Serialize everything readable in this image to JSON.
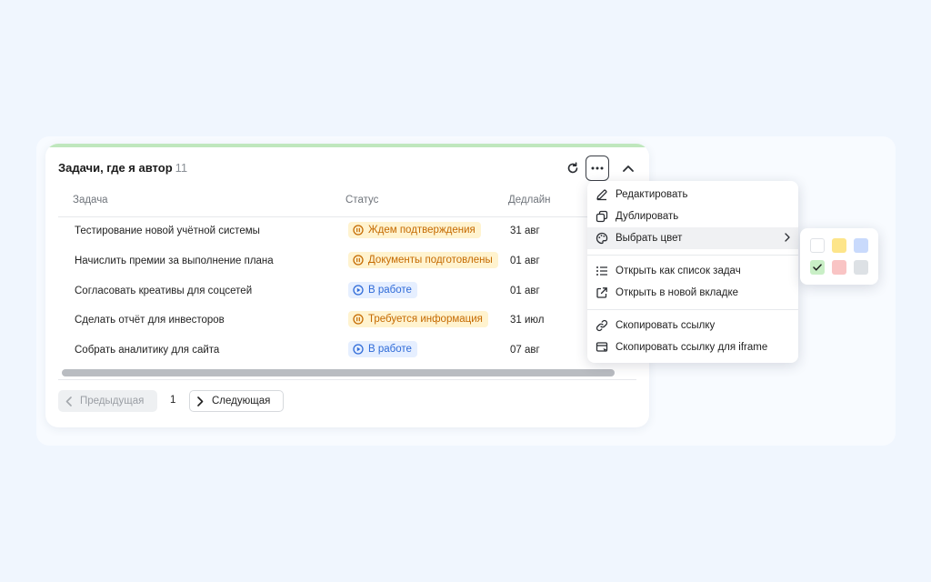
{
  "widget": {
    "title": "Задачи, где я автор",
    "count": "11",
    "accent_color": "#bfe7bd"
  },
  "header_icons": [
    "refresh-icon",
    "more-icon",
    "chevron-up-icon"
  ],
  "table": {
    "columns": [
      "Задача",
      "Статус",
      "Дедлайн"
    ],
    "rows": [
      {
        "task": "Тестирование новой учётной системы",
        "status": "Ждем подтверждения",
        "status_type": "paused",
        "deadline": "31 авг"
      },
      {
        "task": "Начислить премии за выполнение плана",
        "status": "Документы подготовлены",
        "status_type": "paused",
        "deadline": "01 авг"
      },
      {
        "task": "Согласовать креативы для соцсетей",
        "status": "В работе",
        "status_type": "in-progress",
        "deadline": "01 авг"
      },
      {
        "task": "Сделать отчёт для инвесторов",
        "status": "Требуется информация",
        "status_type": "paused",
        "deadline": "31 июл"
      },
      {
        "task": "Собрать аналитику для сайта",
        "status": "В работе",
        "status_type": "in-progress",
        "deadline": "07 авг"
      }
    ]
  },
  "pagination": {
    "prev_label": "Предыдущая",
    "page": "1",
    "next_label": "Следующая"
  },
  "menu": {
    "items": [
      {
        "label": "Редактировать",
        "icon": "pencil-icon"
      },
      {
        "label": "Дублировать",
        "icon": "duplicate-icon"
      },
      {
        "label": "Выбрать цвет",
        "icon": "palette-icon",
        "has_submenu": true
      },
      {
        "label": "Открыть как список задач",
        "icon": "list-icon"
      },
      {
        "label": "Открыть в новой вкладке",
        "icon": "external-link-icon"
      },
      {
        "label": "Скопировать ссылку",
        "icon": "link-icon"
      },
      {
        "label": "Скопировать ссылку для iframe",
        "icon": "iframe-icon"
      }
    ]
  },
  "palette": {
    "colors": [
      "#ffffff",
      "#fde58a",
      "#c9dafc",
      "#c9efc6",
      "#f9c4c4",
      "#dde1e5"
    ],
    "selected": "#c9efc6"
  },
  "colors": {
    "status_paused_bg": "#fff3cf",
    "status_paused_text": "#c56a00",
    "status_in_progress_bg": "#e6efff",
    "status_in_progress_text": "#2f6bd8"
  }
}
